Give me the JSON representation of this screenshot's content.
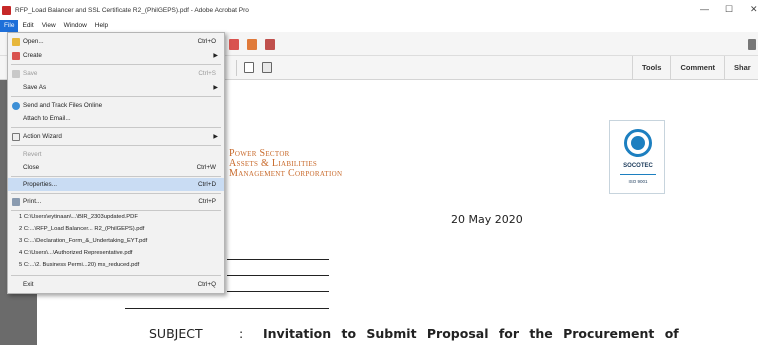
{
  "window": {
    "title": "RFP_Load Balancer and SSL Certificate R2_(PhilGEPS).pdf - Adobe Acrobat Pro",
    "minimize": "—",
    "maximize": "☐",
    "close": "✕"
  },
  "menubar": {
    "items": [
      "File",
      "Edit",
      "View",
      "Window",
      "Help"
    ]
  },
  "toolbar": {
    "tools": "Tools",
    "comment": "Comment",
    "share": "Shar"
  },
  "file_menu": {
    "open": {
      "label": "Open...",
      "shortcut": "Ctrl+O"
    },
    "create": {
      "label": "Create"
    },
    "save": {
      "label": "Save",
      "shortcut": "Ctrl+S"
    },
    "save_as": {
      "label": "Save As"
    },
    "send_track": {
      "label": "Send and Track Files Online"
    },
    "attach_email": {
      "label": "Attach to Email..."
    },
    "action_wizard": {
      "label": "Action Wizard"
    },
    "revert": {
      "label": "Revert"
    },
    "close": {
      "label": "Close",
      "shortcut": "Ctrl+W"
    },
    "properties": {
      "label": "Properties...",
      "shortcut": "Ctrl+D"
    },
    "print": {
      "label": "Print...",
      "shortcut": "Ctrl+P"
    },
    "recent": [
      "1 C:\\Users\\eytinaan\\...\\BIR_2303updated.PDF",
      "2 C:...\\RFP_Load Balancer... R2_(PhilGEPS).pdf",
      "3 C:...\\Declaration_Form_&_Undertaking_EYT.pdf",
      "4 C:\\Users\\...\\Authorized Representative.pdf",
      "5 C:...\\2. Business Permi...20) ms_reduced.pdf"
    ],
    "exit": {
      "label": "Exit",
      "shortcut": "Ctrl+Q"
    }
  },
  "document": {
    "logo_lines": [
      "Power Sector",
      "Assets & Liabilities",
      "Management Corporation"
    ],
    "certifier_name": "SOCOTEC",
    "certifier_iso": "ISO 9001",
    "date": "20 May 2020",
    "subject_label": "SUBJECT",
    "subject_colon": ":",
    "subject_text": "Invitation to Submit Proposal for the Procurement of"
  },
  "colors": {
    "menu_highlight": "#1e6fd9",
    "logo_text": "#c8692a",
    "socotec_blue": "#1c7fc0",
    "doc_background": "#6b6b6b"
  }
}
